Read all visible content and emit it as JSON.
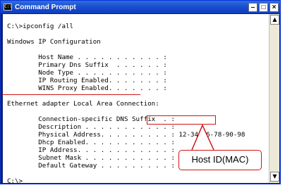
{
  "window": {
    "title": "Command Prompt",
    "icon": "cmd-icon",
    "app_icon_text": "C:\\",
    "minimize": "–",
    "maximize": "□",
    "close": "×"
  },
  "console": {
    "lines": [
      "C:\\>ipconfig /all",
      "",
      "Windows IP Configuration",
      "",
      "        Host Name . . . . . . . . . . . :",
      "        Primary Dns Suffix  . . . . . . :",
      "        Node Type . . . . . . . . . . . :",
      "        IP Routing Enabled. . . . . . . :",
      "        WINS Proxy Enabled. . . . . . . :",
      "",
      "Ethernet adapter Local Area Connection:",
      "",
      "        Connection-specific DNS Suffix  . :",
      "        Description . . . . . . . . . . . :",
      "        Physical Address. . . . . . . . . : 12-34-56-78-90-98",
      "        Dhcp Enabled. . . . . . . . . . . :",
      "        IP Address. . . . . . . . . . . . :",
      "        Subnet Mask . . . . . . . . . . . :",
      "        Default Gateway . . . . . . . . . :",
      "",
      "C:\\>"
    ]
  },
  "scrollbar": {
    "up": "▲",
    "down": "▼"
  },
  "annotation": {
    "label": "Host ID(MAC)",
    "color": "#d01414"
  }
}
